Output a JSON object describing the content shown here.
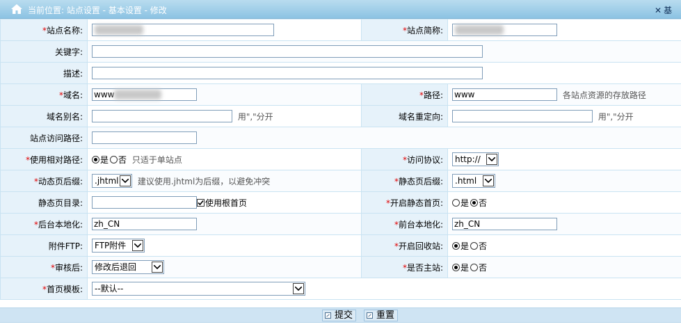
{
  "header": {
    "location": "当前位置: 站点设置 - 基本设置 - 修改",
    "tools_label": "基"
  },
  "rows": {
    "site_name": {
      "label": "站点名称:",
      "value": ""
    },
    "site_short": {
      "label": "站点简称:",
      "value": ""
    },
    "keywords": {
      "label": "关键字:",
      "value": ""
    },
    "description": {
      "label": "描述:",
      "value": ""
    },
    "domain": {
      "label": "域名:",
      "value": "www"
    },
    "path": {
      "label": "路径:",
      "value": "www",
      "hint": "各站点资源的存放路径"
    },
    "domain_alias": {
      "label": "域名别名:",
      "value": "",
      "hint": "用\",\"分开"
    },
    "domain_redirect": {
      "label": "域名重定向:",
      "value": "",
      "hint": "用\",\"分开"
    },
    "access_path": {
      "label": "站点访问路径:",
      "value": ""
    },
    "relative_path": {
      "label": "使用相对路径:",
      "yes": "是",
      "no": "否",
      "selected": "yes",
      "hint": "只适于单站点"
    },
    "protocol": {
      "label": "访问协议:",
      "value": "http://"
    },
    "dynamic_suffix": {
      "label": "动态页后缀:",
      "value": ".jhtml",
      "hint": "建议使用.jhtml为后缀，以避免冲突"
    },
    "static_suffix": {
      "label": "静态页后缀:",
      "value": ".html"
    },
    "static_dir": {
      "label": "静态页目录:",
      "value": "",
      "checkbox_label": "使用根首页",
      "checked": true
    },
    "static_index": {
      "label": "开启静态首页:",
      "yes": "是",
      "no": "否",
      "selected": "no"
    },
    "admin_locale": {
      "label": "后台本地化:",
      "value": "zh_CN"
    },
    "front_locale": {
      "label": "前台本地化:",
      "value": "zh_CN"
    },
    "ftp": {
      "label": "附件FTP:",
      "value": "FTP附件"
    },
    "recycle": {
      "label": "开启回收站:",
      "yes": "是",
      "no": "否",
      "selected": "yes"
    },
    "after_audit": {
      "label": "审核后:",
      "value": "修改后退回"
    },
    "main_site": {
      "label": "是否主站:",
      "yes": "是",
      "no": "否",
      "selected": "yes"
    },
    "index_template": {
      "label": "首页模板:",
      "value": "--默认--"
    }
  },
  "required_mark": "*",
  "buttons": {
    "submit": "提交",
    "reset": "重置"
  },
  "colors": {
    "header": "#8cc3e3",
    "label_bg": "#e6f2fa",
    "required": "#e00000"
  }
}
